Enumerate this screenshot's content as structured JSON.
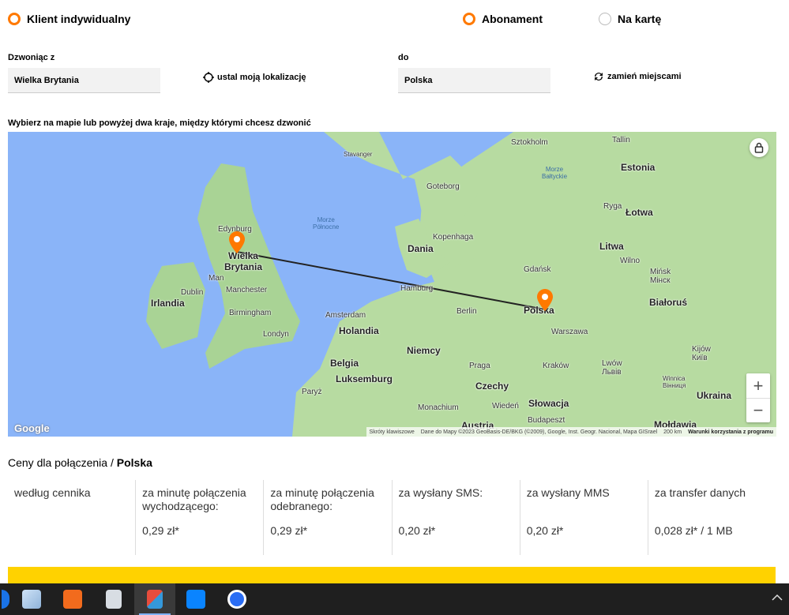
{
  "radios": {
    "individual": "Klient indywidualny",
    "abonament": "Abonament",
    "na_karte": "Na kartę"
  },
  "form": {
    "from_label": "Dzwoniąc z",
    "from_value": "Wielka Brytania",
    "locate_label": "ustal moją lokalizację",
    "to_label": "do",
    "to_value": "Polska",
    "swap_label": "zamień miejscami"
  },
  "map": {
    "hint": "Wybierz na mapie lub powyżej dwa kraje, między którymi chcesz dzwonić",
    "labels": {
      "sztokholm": "Sztokholm",
      "tallin": "Tallin",
      "stavanger": "Stavanger",
      "estonia": "Estonia",
      "morze_baltyckie": "Morze\nBałtyckie",
      "goteborg": "Goteborg",
      "ryga": "Ryga",
      "lotwa": "Łotwa",
      "edynburg": "Edynburg",
      "morze_polnocne": "Morze\nPółnocne",
      "kopenhaga": "Kopenhaga",
      "dania": "Dania",
      "litwa": "Litwa",
      "wielka_brytania": "Wielka\nBrytania",
      "wilno": "Wilno",
      "gdansk": "Gdańsk",
      "man": "Man",
      "minsk": "Mińsk\nМінск",
      "dublin": "Dublin",
      "irlandia": "Irlandia",
      "manchester": "Manchester",
      "hamburg": "Hamburg",
      "polska": "Polska",
      "bialorus": "Białoruś",
      "berlin": "Berlin",
      "birmingham": "Birmingham",
      "amsterdam": "Amsterdam",
      "holandia": "Holandia",
      "londyn": "Londyn",
      "warszawa": "Warszawa",
      "niemcy": "Niemcy",
      "kijow": "Kijów\nКиїв",
      "belgia": "Belgia",
      "praga": "Praga",
      "krakow": "Kraków",
      "lwow": "Lwów\nЛьвів",
      "luksemburg": "Luksemburg",
      "czechy": "Czechy",
      "winnica": "Winnica\nВінниця",
      "paryz": "Paryż",
      "slowacja": "Słowacja",
      "ukraina": "Ukraina",
      "monachium": "Monachium",
      "wieden": "Wiedeń",
      "budapeszt": "Budapeszt",
      "austria": "Austria",
      "moldawia": "Mołdawia"
    },
    "google": "Google",
    "attrib_shortcuts": "Skróty klawiszowe",
    "attrib_data": "Dane do Mapy ©2023 GeoBasis-DE/BKG (©2009), Google, Inst. Geogr. Nacional, Mapa GISrael",
    "attrib_scale": "200 km",
    "attrib_terms": "Warunki korzystania z programu",
    "zoom_in": "+",
    "zoom_out": "−"
  },
  "prices": {
    "title_prefix": "Ceny dla połączenia / ",
    "title_country": "Polska",
    "columns": [
      {
        "header": "według cennika",
        "value": ""
      },
      {
        "header": "za minutę połączenia wychodzącego:",
        "value": "0,29 zł*"
      },
      {
        "header": "za minutę połączenia odebranego:",
        "value": "0,29 zł*"
      },
      {
        "header": "za wysłany SMS:",
        "value": "0,20 zł*"
      },
      {
        "header": "za wysłany MMS",
        "value": "0,20 zł*"
      },
      {
        "header": "za transfer danych",
        "value": "0,028 zł* / 1 MB"
      }
    ]
  },
  "colors": {
    "accent": "#ff7900",
    "banner": "#ffd200",
    "sea": "#8ab4f8",
    "land": "#b7dba1"
  },
  "taskbar": {
    "icons": [
      "browser-icon",
      "photos-icon",
      "rocket-app-icon",
      "calculator-icon",
      "snipping-tool-icon",
      "store-icon",
      "messenger-icon"
    ]
  }
}
